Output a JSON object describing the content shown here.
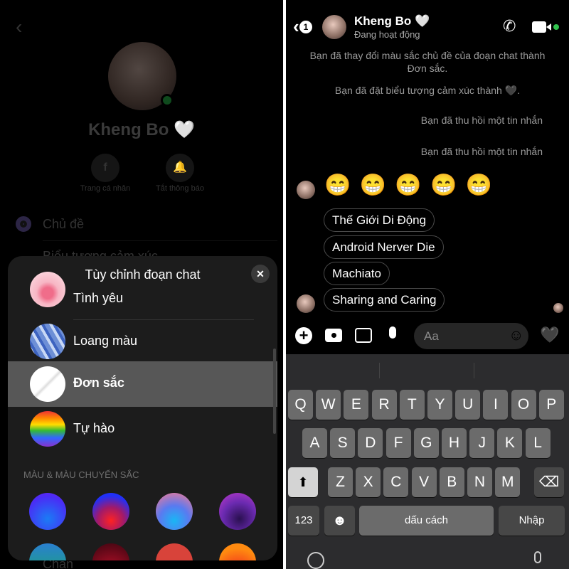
{
  "profile": {
    "name": "Kheng Bo 🤍",
    "actions": [
      {
        "label": "Trang cá nhân",
        "icon": "facebook-icon"
      },
      {
        "label": "Tắt thông báo",
        "icon": "bell-icon"
      }
    ],
    "menu": [
      {
        "label": "Chủ đề",
        "icon": "theme-icon"
      },
      {
        "label": "Biểu tượng cảm xúc",
        "icon": "heart-icon"
      },
      {
        "label": "Chặn",
        "icon": "block-icon"
      }
    ]
  },
  "sheet": {
    "title": "Tùy chỉnh đoạn chat",
    "close": "✕",
    "themes": [
      {
        "label": "Tình yêu"
      },
      {
        "label": "Loang màu"
      },
      {
        "label": "Đơn sắc",
        "selected": true
      },
      {
        "label": "Tự hào"
      }
    ],
    "section": "MÀU & MÀU CHUYỂN SẮC"
  },
  "chat": {
    "back_badge": "1",
    "name": "Kheng Bo 🤍",
    "status": "Đang hoạt động",
    "online_color": "#31c24d",
    "system": [
      "Bạn đã thay đổi màu sắc chủ đề của đoạn chat thành Đơn sắc.",
      "Bạn đã đặt biểu tượng cảm xúc thành 🖤.",
      "Bạn đã thu hồi một tin nhắn",
      "Bạn đã thu hồi một tin nhắn"
    ],
    "emoji_row": "😁 😁 😁 😁 😁",
    "messages": [
      "Thế Giới Di Động",
      "Android Nerver Die",
      "Machiato",
      "Sharing and Caring"
    ],
    "input_placeholder": "Aa",
    "like": "🖤"
  },
  "keyboard": {
    "row1": [
      "Q",
      "W",
      "E",
      "R",
      "T",
      "Y",
      "U",
      "I",
      "O",
      "P"
    ],
    "row2": [
      "A",
      "S",
      "D",
      "F",
      "G",
      "H",
      "J",
      "K",
      "L"
    ],
    "row3": [
      "Z",
      "X",
      "C",
      "V",
      "B",
      "N",
      "M"
    ],
    "num": "123",
    "emoji": "☻",
    "space": "dấu cách",
    "enter": "Nhập",
    "shift": "⬆",
    "backspace": "⌫"
  }
}
